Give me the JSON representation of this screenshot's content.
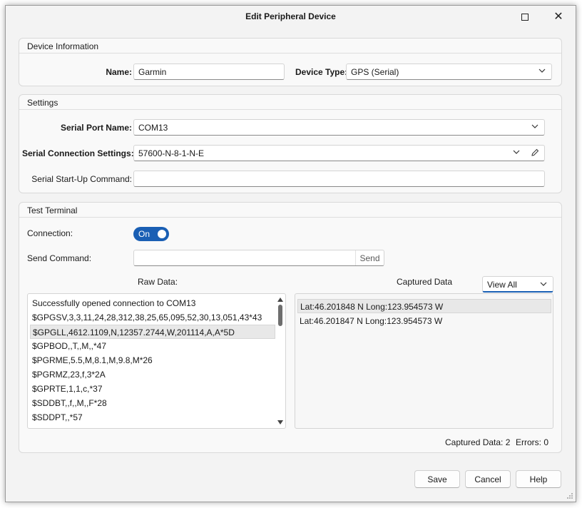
{
  "window": {
    "title": "Edit Peripheral Device"
  },
  "device_info": {
    "header": "Device Information",
    "name_label": "Name:",
    "name_value": "Garmin",
    "type_label": "Device Type:",
    "type_value": "GPS (Serial)"
  },
  "settings": {
    "header": "Settings",
    "port_label": "Serial Port Name:",
    "port_value": "COM13",
    "conn_label": "Serial Connection Settings:",
    "conn_value": "57600-N-8-1-N-E",
    "startup_label": "Serial Start-Up Command:",
    "startup_value": ""
  },
  "terminal": {
    "header": "Test Terminal",
    "connection_label": "Connection:",
    "toggle_label": "On",
    "send_label": "Send Command:",
    "send_value": "",
    "send_button": "Send",
    "raw_label": "Raw Data:",
    "captured_label": "Captured Data",
    "view_value": "View All",
    "raw_lines": [
      "Successfully opened connection to COM13",
      "$GPGSV,3,3,11,24,28,312,38,25,65,095,52,30,13,051,43*43",
      "$GPGLL,4612.1109,N,12357.2744,W,201114,A,A*5D",
      "$GPBOD,,T,,M,,*47",
      "$PGRME,5.5,M,8.1,M,9.8,M*26",
      "$PGRMZ,23,f,3*2A",
      "$GPRTE,1,1,c,*37",
      "$SDDBT,,f,,M,,F*28",
      "$SDDPT,,*57"
    ],
    "captured_lines": [
      "Lat:46.201848 N   Long:123.954573 W",
      "Lat:46.201847 N   Long:123.954573 W"
    ],
    "status_captured": "Captured Data: 2",
    "status_errors": "Errors: 0"
  },
  "buttons": {
    "save": "Save",
    "cancel": "Cancel",
    "help": "Help"
  },
  "colors": {
    "accent": "#1a5fb4",
    "background": "#f3f3f3"
  }
}
